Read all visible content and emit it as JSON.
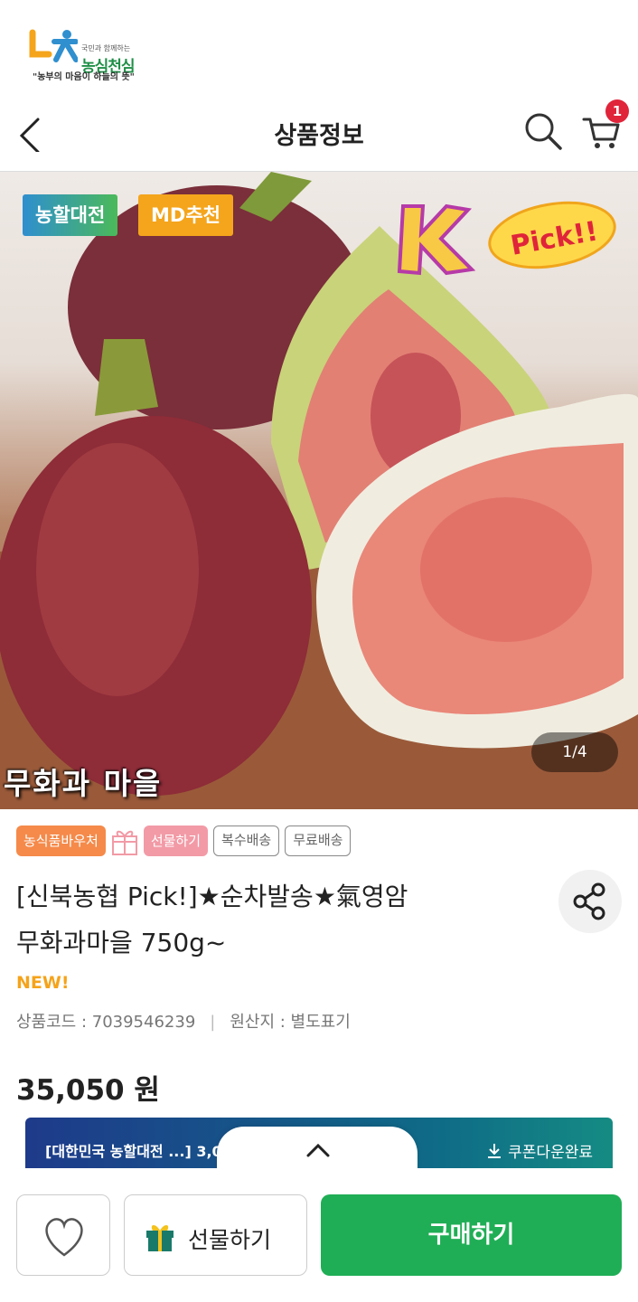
{
  "brand": {
    "tagline_small": "국민과 함께하는",
    "name": "농심천심",
    "slogan": "\"농부의 마음이 하늘의 뜻\""
  },
  "header": {
    "title": "상품정보",
    "cart_count": "1"
  },
  "gallery": {
    "badges": [
      "농할대전",
      "MD추천"
    ],
    "counter": "1/4",
    "caption": "무화과 마을",
    "sticker": "Pick!!"
  },
  "tags": {
    "voucher": "농식품바우처",
    "gift": "선물하기",
    "multi_ship": "복수배송",
    "free_ship": "무료배송"
  },
  "product": {
    "title_line1": "[신북농협 Pick!]★순차발송★氣영암",
    "title_line2": "무화과마을 750g~",
    "new_label": "NEW!",
    "code": "상품코드 : 7039546239",
    "origin": "원산지 : 별도표기",
    "price": "35,050 원"
  },
  "coupon": {
    "text": "[대한민국 농할대전 ...] 3,0",
    "download": "쿠폰다운완료"
  },
  "bottom": {
    "gift_label": "선물하기",
    "buy_label": "구매하기"
  },
  "colors": {
    "buy_green": "#1fae55",
    "cart_badge": "#e0243a",
    "new_orange": "#f5a31a"
  }
}
